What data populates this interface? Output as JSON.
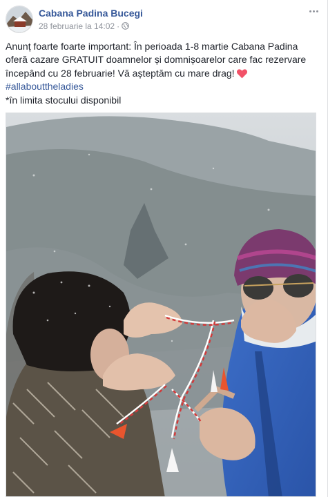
{
  "post": {
    "page_name": "Cabana Padina Bucegi",
    "timestamp": "28 februarie la 14:02",
    "separator": "·",
    "privacy_icon": "globe-icon",
    "more_icon": "ellipsis-icon",
    "text_line1": "Anunț foarte foarte important: În perioada 1-8 martie Cabana Padina",
    "text_line2": "oferă cazare GRATUIT doamnelor și domnișoarelor care fac rezervare",
    "text_line3": "începând cu 28 februarie! Vă așteptăm cu mare drag!",
    "heart_icon": "heart-icon",
    "hashtag": "#allabouttheladies",
    "footnote": "*în limita stocului disponibil"
  },
  "colors": {
    "link": "#365899",
    "text": "#1d2129",
    "meta": "#90949c",
    "heart": "#f25268"
  }
}
